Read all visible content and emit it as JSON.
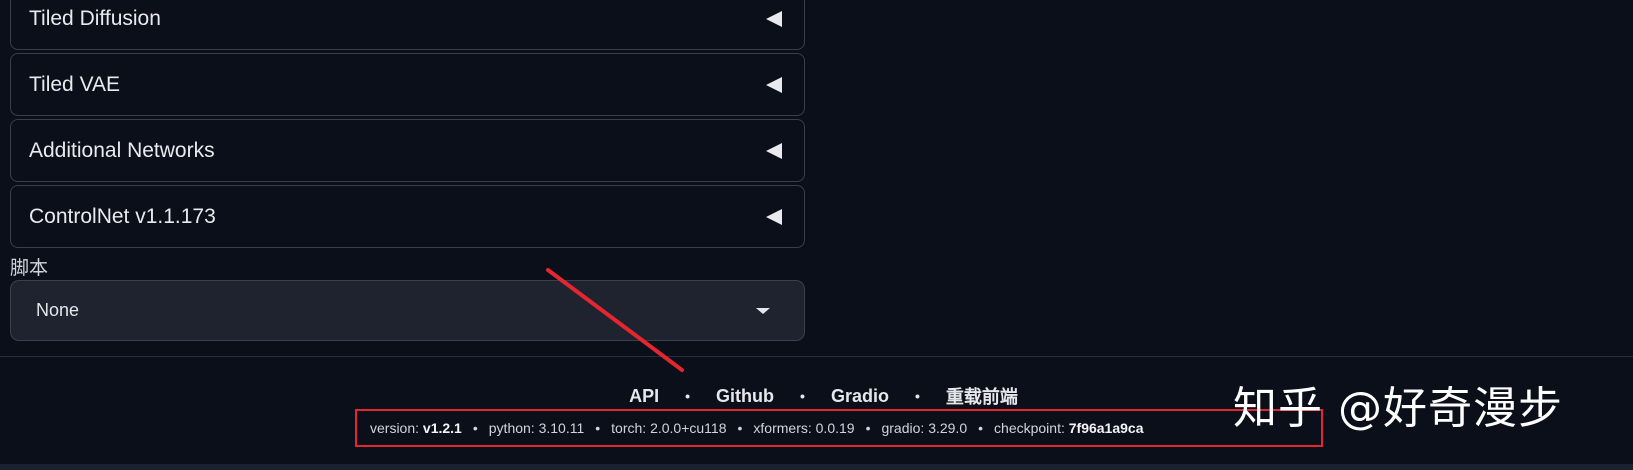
{
  "accordions": [
    {
      "label": "Tiled Diffusion"
    },
    {
      "label": "Tiled VAE"
    },
    {
      "label": "Additional Networks"
    },
    {
      "label": "ControlNet v1.1.173"
    }
  ],
  "scripts": {
    "label": "脚本",
    "selected": "None"
  },
  "footer": {
    "links": [
      "API",
      "Github",
      "Gradio",
      "重载前端"
    ],
    "separator": "•",
    "versions": [
      {
        "key": "version: ",
        "value": "v1.2.1",
        "bold": true
      },
      {
        "key": "python: ",
        "value": "3.10.11",
        "bold": false
      },
      {
        "key": "torch: ",
        "value": "2.0.0+cu118",
        "bold": false
      },
      {
        "key": "xformers: ",
        "value": "0.0.19",
        "bold": false
      },
      {
        "key": "gradio: ",
        "value": "3.29.0",
        "bold": false
      },
      {
        "key": "checkpoint: ",
        "value": "7f96a1a9ca",
        "bold": true
      }
    ]
  },
  "annotation": {
    "color": "#e3262f"
  },
  "watermark": {
    "text": "知乎 @好奇漫步"
  }
}
